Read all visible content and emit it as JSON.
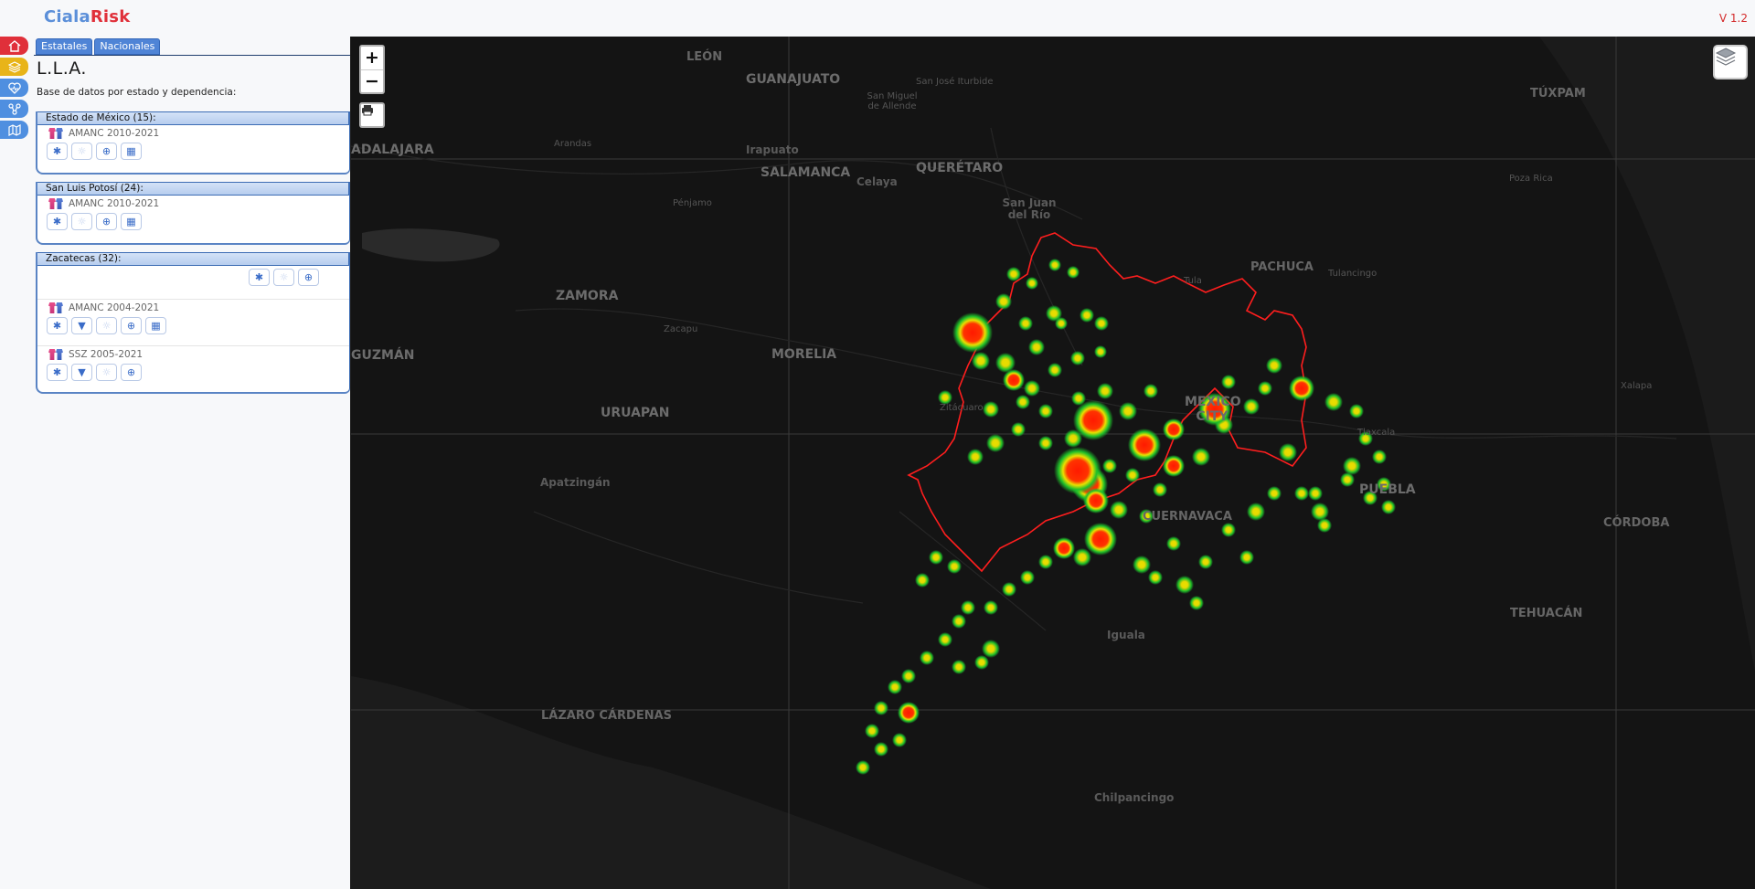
{
  "app": {
    "logo_part1": "Ciala",
    "logo_part2": "Risk",
    "version": "V 1.2"
  },
  "rail": [
    "home-icon",
    "layers-icon",
    "health-icon",
    "network-icon",
    "map-icon"
  ],
  "tabs": [
    {
      "label": "Estatales"
    },
    {
      "label": "Nacionales"
    }
  ],
  "panel": {
    "title": "L.L.A.",
    "subtitle": "Base de datos por estado y dependencia:"
  },
  "groups": [
    {
      "header": "Estado de México (15):",
      "datasets": [
        {
          "name": "AMANC 2010-2021",
          "buttons": [
            "asterisk",
            "sun",
            "target",
            "table"
          ]
        }
      ]
    },
    {
      "header": "San Luis Potosí (24):",
      "datasets": [
        {
          "name": "AMANC 2010-2021",
          "buttons": [
            "asterisk",
            "sun",
            "target",
            "table"
          ]
        }
      ]
    },
    {
      "header": "Zacatecas (32):",
      "group_buttons": [
        "asterisk",
        "sun",
        "target"
      ],
      "datasets": [
        {
          "name": "AMANC 2004-2021",
          "buttons": [
            "asterisk",
            "filter",
            "sun",
            "target",
            "table"
          ]
        },
        {
          "name": "SSZ 2005-2021",
          "buttons": [
            "asterisk",
            "filter",
            "sun",
            "target"
          ]
        }
      ]
    }
  ],
  "map": {
    "zoom_in": "+",
    "zoom_out": "−",
    "labels": [
      "LEÓN",
      "GUANAJUATO",
      "San José Iturbide",
      "San Miguel de Allende",
      "TÚXPAM",
      "ADALAJARA",
      "Arandas",
      "Irapuato",
      "SALAMANCA",
      "Celaya",
      "QUERÉTARO",
      "Poza Rica",
      "Pénjamo",
      "San Juan del Río",
      "PACHUCA",
      "Tula",
      "Tulancingo",
      "ZAMORA",
      "Zacapu",
      "MORELIA",
      "GUZMÁN",
      "URUAPAN",
      "Zitácuaro",
      "MEXICO CITY",
      "Xalapa",
      "Tlaxcala",
      "Apatzingán",
      "PUEBLA",
      "CUERNAVACA",
      "CÓRDOBA",
      "TEHUACÁN",
      "Iguala",
      "LÁZARO CÁRDENAS",
      "Chilpancingo"
    ],
    "colors": {
      "boundary": "#ff1e1e",
      "heat_core": "#ff1a00",
      "heat_mid": "#e8e000",
      "heat_edge": "#1fbf2a"
    }
  }
}
